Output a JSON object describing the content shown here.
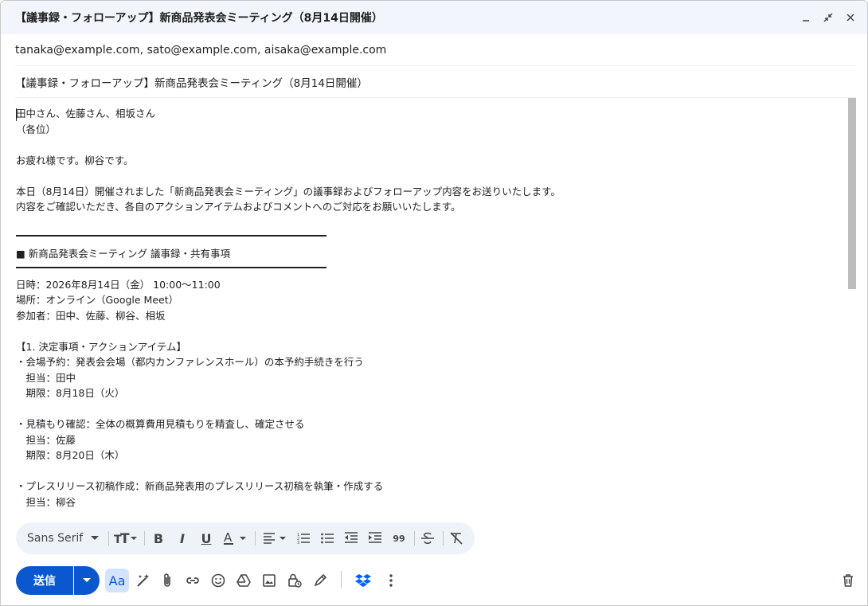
{
  "window": {
    "title": "【議事録・フォローアップ】新商品発表会ミーティング（8月14日開催）",
    "minimize_icon": "minimize-icon",
    "exit_fullscreen_icon": "exit-fullscreen-icon",
    "close_icon": "close-icon"
  },
  "recipients": "tanaka@example.com, sato@example.com, aisaka@example.com",
  "subject": "【議事録・フォローアップ】新商品発表会ミーティング（8月14日開催）",
  "body": {
    "lines": [
      "田中さん、佐藤さん、相坂さん",
      "（各位）",
      "",
      "お疲れ様です。柳谷です。",
      "",
      "本日（8月14日）開催されました「新商品発表会ミーティング」の議事録およびフォローアップ内容をお送りいたします。",
      "内容をご確認いただき、各自のアクションアイテムおよびコメントへのご対応をお願いいたします。",
      "",
      "",
      "■ 新商品発表会ミーティング 議事録・共有事項",
      "",
      "日時：2026年8月14日（金） 10:00～11:00",
      "場所：オンライン（Google Meet）",
      "参加者：田中、佐藤、柳谷、相坂",
      "",
      "【1. 決定事項・アクションアイテム】",
      "・会場予約：発表会会場（都内カンファレンスホール）の本予約手続きを行う",
      "　担当：田中",
      "　期限：8月18日（火）",
      "",
      "・見積もり確認：全体の概算費用見積もりを精査し、確定させる",
      "　担当：佐藤",
      "　期限：8月20日（木）",
      "",
      "・プレスリリース初稿作成：新商品発表用のプレスリリース初稿を執筆・作成する",
      "　担当：柳谷"
    ]
  },
  "format_toolbar": {
    "font_name": "Sans Serif",
    "icons": [
      "font-size-icon",
      "bold-icon",
      "italic-icon",
      "underline-icon",
      "text-color-icon",
      "align-icon",
      "numbered-list-icon",
      "bulleted-list-icon",
      "indent-less-icon",
      "indent-more-icon",
      "quote-icon",
      "strikethrough-icon",
      "remove-formatting-icon"
    ],
    "quote_glyph": "99"
  },
  "bottom_toolbar": {
    "send_label": "送信",
    "formatting_label": "Aa",
    "icons": [
      "more-send-options-icon",
      "formatting-options-icon",
      "help-me-write-icon",
      "attach-icon",
      "link-icon",
      "emoji-icon",
      "drive-icon",
      "photo-icon",
      "confidential-icon",
      "signature-icon",
      "dropbox-icon",
      "more-options-icon",
      "trash-icon"
    ]
  },
  "colors": {
    "send_blue": "#0b57d0",
    "title_bg": "#f2f6fc",
    "toolbar_bg": "#eef2f9",
    "dropbox_blue": "#0061fe"
  }
}
